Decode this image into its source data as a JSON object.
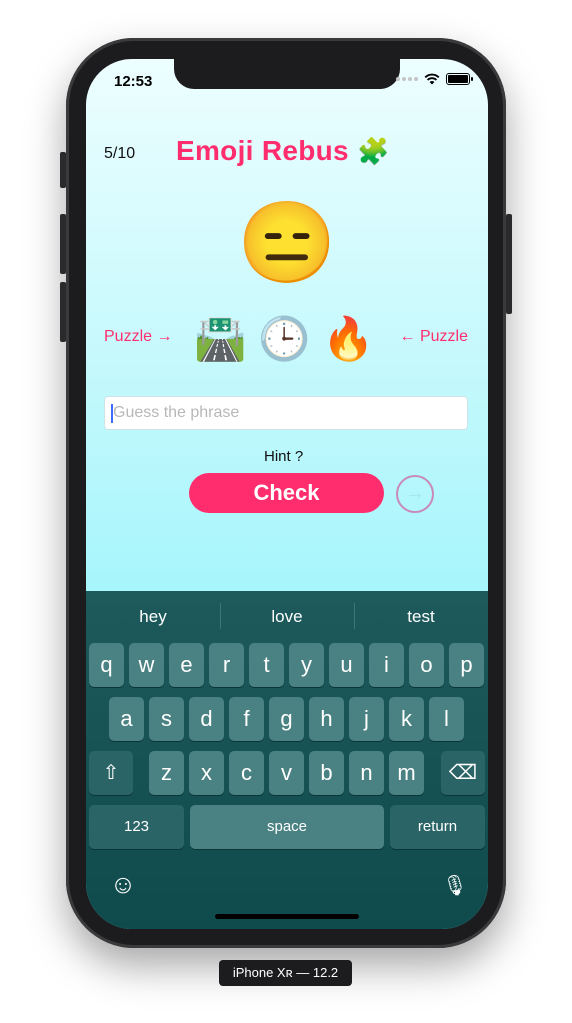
{
  "status_bar": {
    "time": "12:53"
  },
  "game": {
    "progress": "5/10",
    "title": "Emoji Rebus",
    "title_icon": "🧩",
    "reaction_emoji": "😑",
    "puzzle_label_left": "Puzzle →",
    "puzzle_label_right": "← Puzzle",
    "puzzle_emojis": [
      "🛣️",
      "🕒",
      "🔥"
    ],
    "input": {
      "placeholder": "Guess the phrase",
      "value": ""
    },
    "hint_label": "Hint ?",
    "check_label": "Check",
    "next_label": "→"
  },
  "keyboard": {
    "suggestions": [
      "hey",
      "love",
      "test"
    ],
    "row1": [
      "q",
      "w",
      "e",
      "r",
      "t",
      "y",
      "u",
      "i",
      "o",
      "p"
    ],
    "row2": [
      "a",
      "s",
      "d",
      "f",
      "g",
      "h",
      "j",
      "k",
      "l"
    ],
    "row3": [
      "z",
      "x",
      "c",
      "v",
      "b",
      "n",
      "m"
    ],
    "shift_glyph": "⇧",
    "delete_glyph": "⌫",
    "numbers_label": "123",
    "space_label": "space",
    "return_label": "return",
    "emoji_glyph": "☺",
    "mic_glyph": "🎙"
  },
  "device_label": "iPhone Xʀ — 12.2",
  "colors": {
    "accent": "#ff2d6e",
    "keyboard_bg": "#1e5a5c",
    "key": "#4a8182"
  }
}
